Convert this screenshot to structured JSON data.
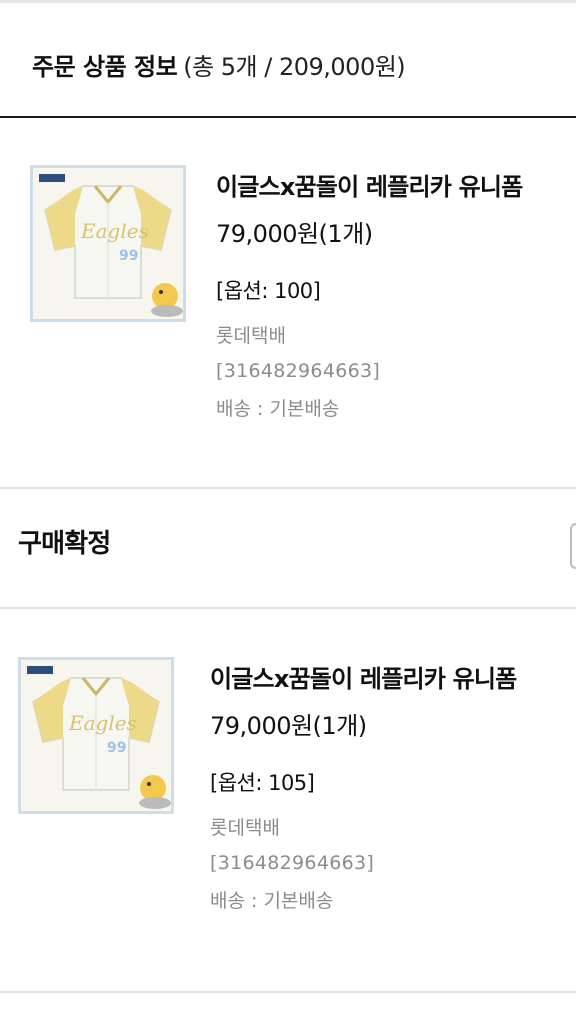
{
  "header": {
    "title": "주문 상품 정보",
    "summary": "(총 5개 / 209,000원)"
  },
  "items": [
    {
      "name": "이글스x꿈돌이 레플리카 유니폼",
      "price": "79,000원(1개)",
      "option": "[옵션: 100]",
      "courier": "롯데택배",
      "tracking": "[316482964663]",
      "shipping": "배송 : 기본배송",
      "jersey_number": "99"
    },
    {
      "name": "이글스x꿈돌이 레플리카 유니폼",
      "price": "79,000원(1개)",
      "option": "[옵션: 105]",
      "courier": "롯데택배",
      "tracking": "[316482964663]",
      "shipping": "배송 : 기본배송",
      "jersey_number": "99"
    }
  ],
  "status": {
    "label": "구매확정"
  },
  "colors": {
    "jersey_body": "#f7f7f2",
    "jersey_sleeve": "#ecd98a",
    "jersey_number": "#9cc3e3",
    "thumb_border": "#cfdde8",
    "muted_text": "#8c8c8c"
  }
}
